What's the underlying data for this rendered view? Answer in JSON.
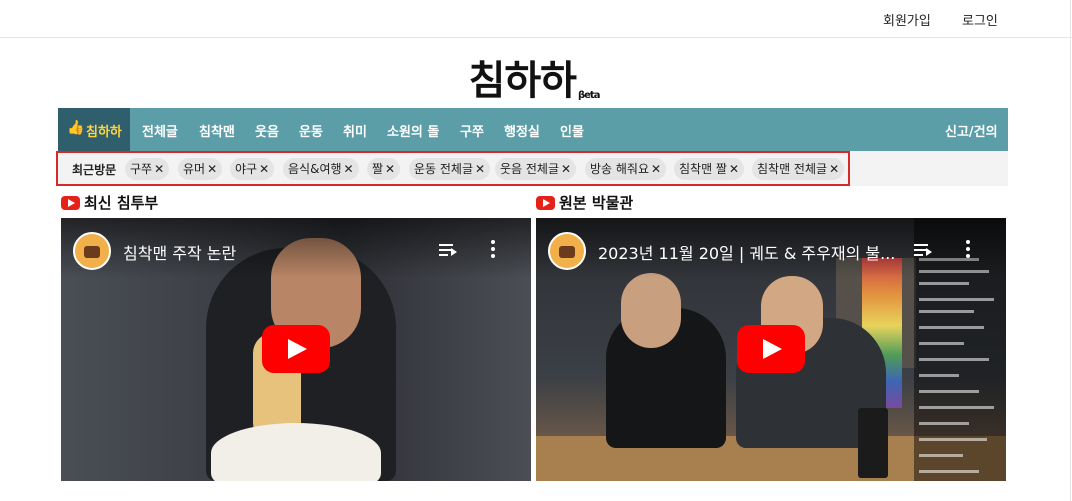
{
  "header": {
    "signup_label": "회원가입",
    "login_label": "로그인"
  },
  "logo": {
    "text": "침하하",
    "badge": "βeta"
  },
  "nav": {
    "home_label": "침하하",
    "home_icon": "thumbs-up-icon",
    "items": [
      "전체글",
      "침착맨",
      "웃음",
      "운동",
      "취미",
      "소원의 돌",
      "구쭈",
      "행정실",
      "인물"
    ],
    "report_label": "신고/건의",
    "bg_color": "#5b9ea8",
    "home_bg_color": "#2f5f6c",
    "home_text_color": "#ffd33d"
  },
  "recent": {
    "title": "최근방문",
    "chips": [
      "구쭈",
      "유머",
      "야구",
      "음식&여행",
      "짤",
      "운동 전체글",
      "웃음 전체글",
      "방송 해줘요",
      "침착맨 짤",
      "침착맨 전체글"
    ],
    "remove_glyph": "✕",
    "highlight_color": "#d7282a"
  },
  "sections": {
    "left_title": "최신 침투부",
    "right_title": "원본 박물관"
  },
  "videos": {
    "left": {
      "title": "침착맨 주작 논란",
      "icon": "play-icon"
    },
    "right": {
      "title": "2023년 11월 20일 | 궤도 & 주우재의 불...",
      "icon": "play-icon"
    }
  }
}
